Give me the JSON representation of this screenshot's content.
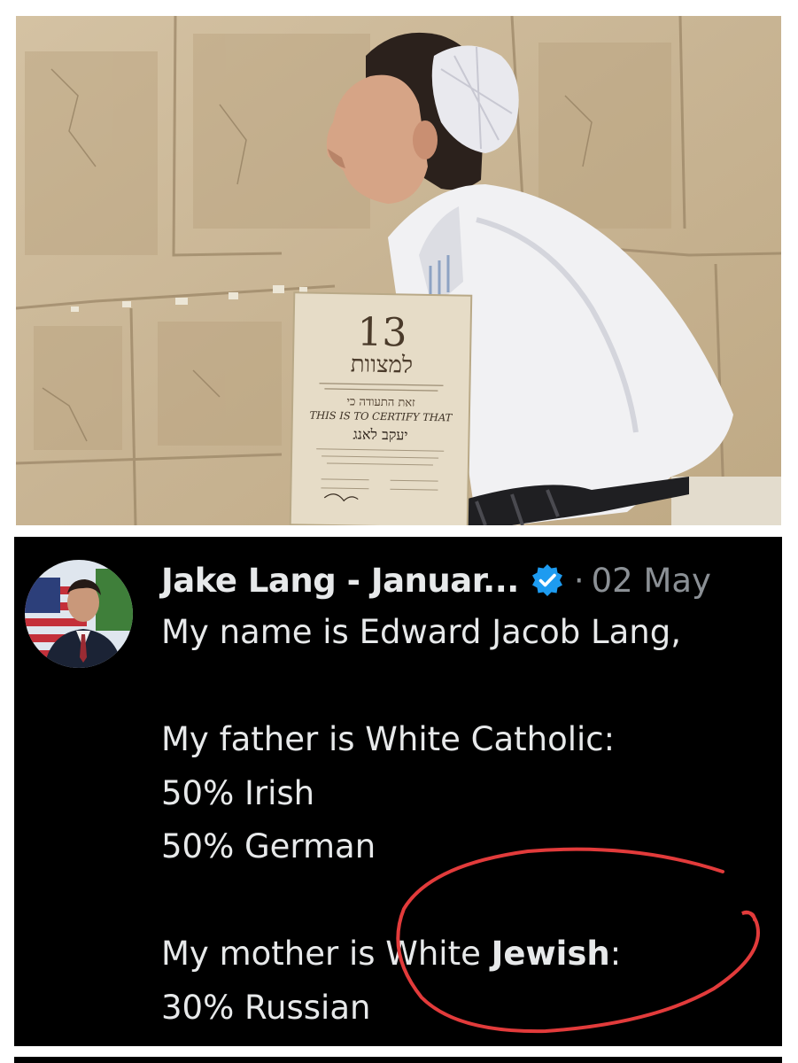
{
  "photo": {
    "certificate": {
      "big_number": "13",
      "hebrew_title": "למצוות",
      "hebrew_line": "זאת התעודה כי",
      "english_line": "THIS IS TO CERTIFY THAT",
      "name_hebrew": "יעקב לאנג"
    }
  },
  "tweet": {
    "author_name": "Jake Lang - Januar...",
    "separator": "·",
    "date": "02 May",
    "lines": {
      "l1": "My name is Edward Jacob Lang,",
      "l3": "My father is White Catholic:",
      "l4": "50% Irish",
      "l5": "50% German",
      "l7_a": "My mother is White ",
      "l7_b": "Jewish",
      "l7_c": ":",
      "l8": "30% Russian"
    }
  },
  "colors": {
    "verified": "#1d9bf0",
    "annotation": "#e23b3b"
  }
}
